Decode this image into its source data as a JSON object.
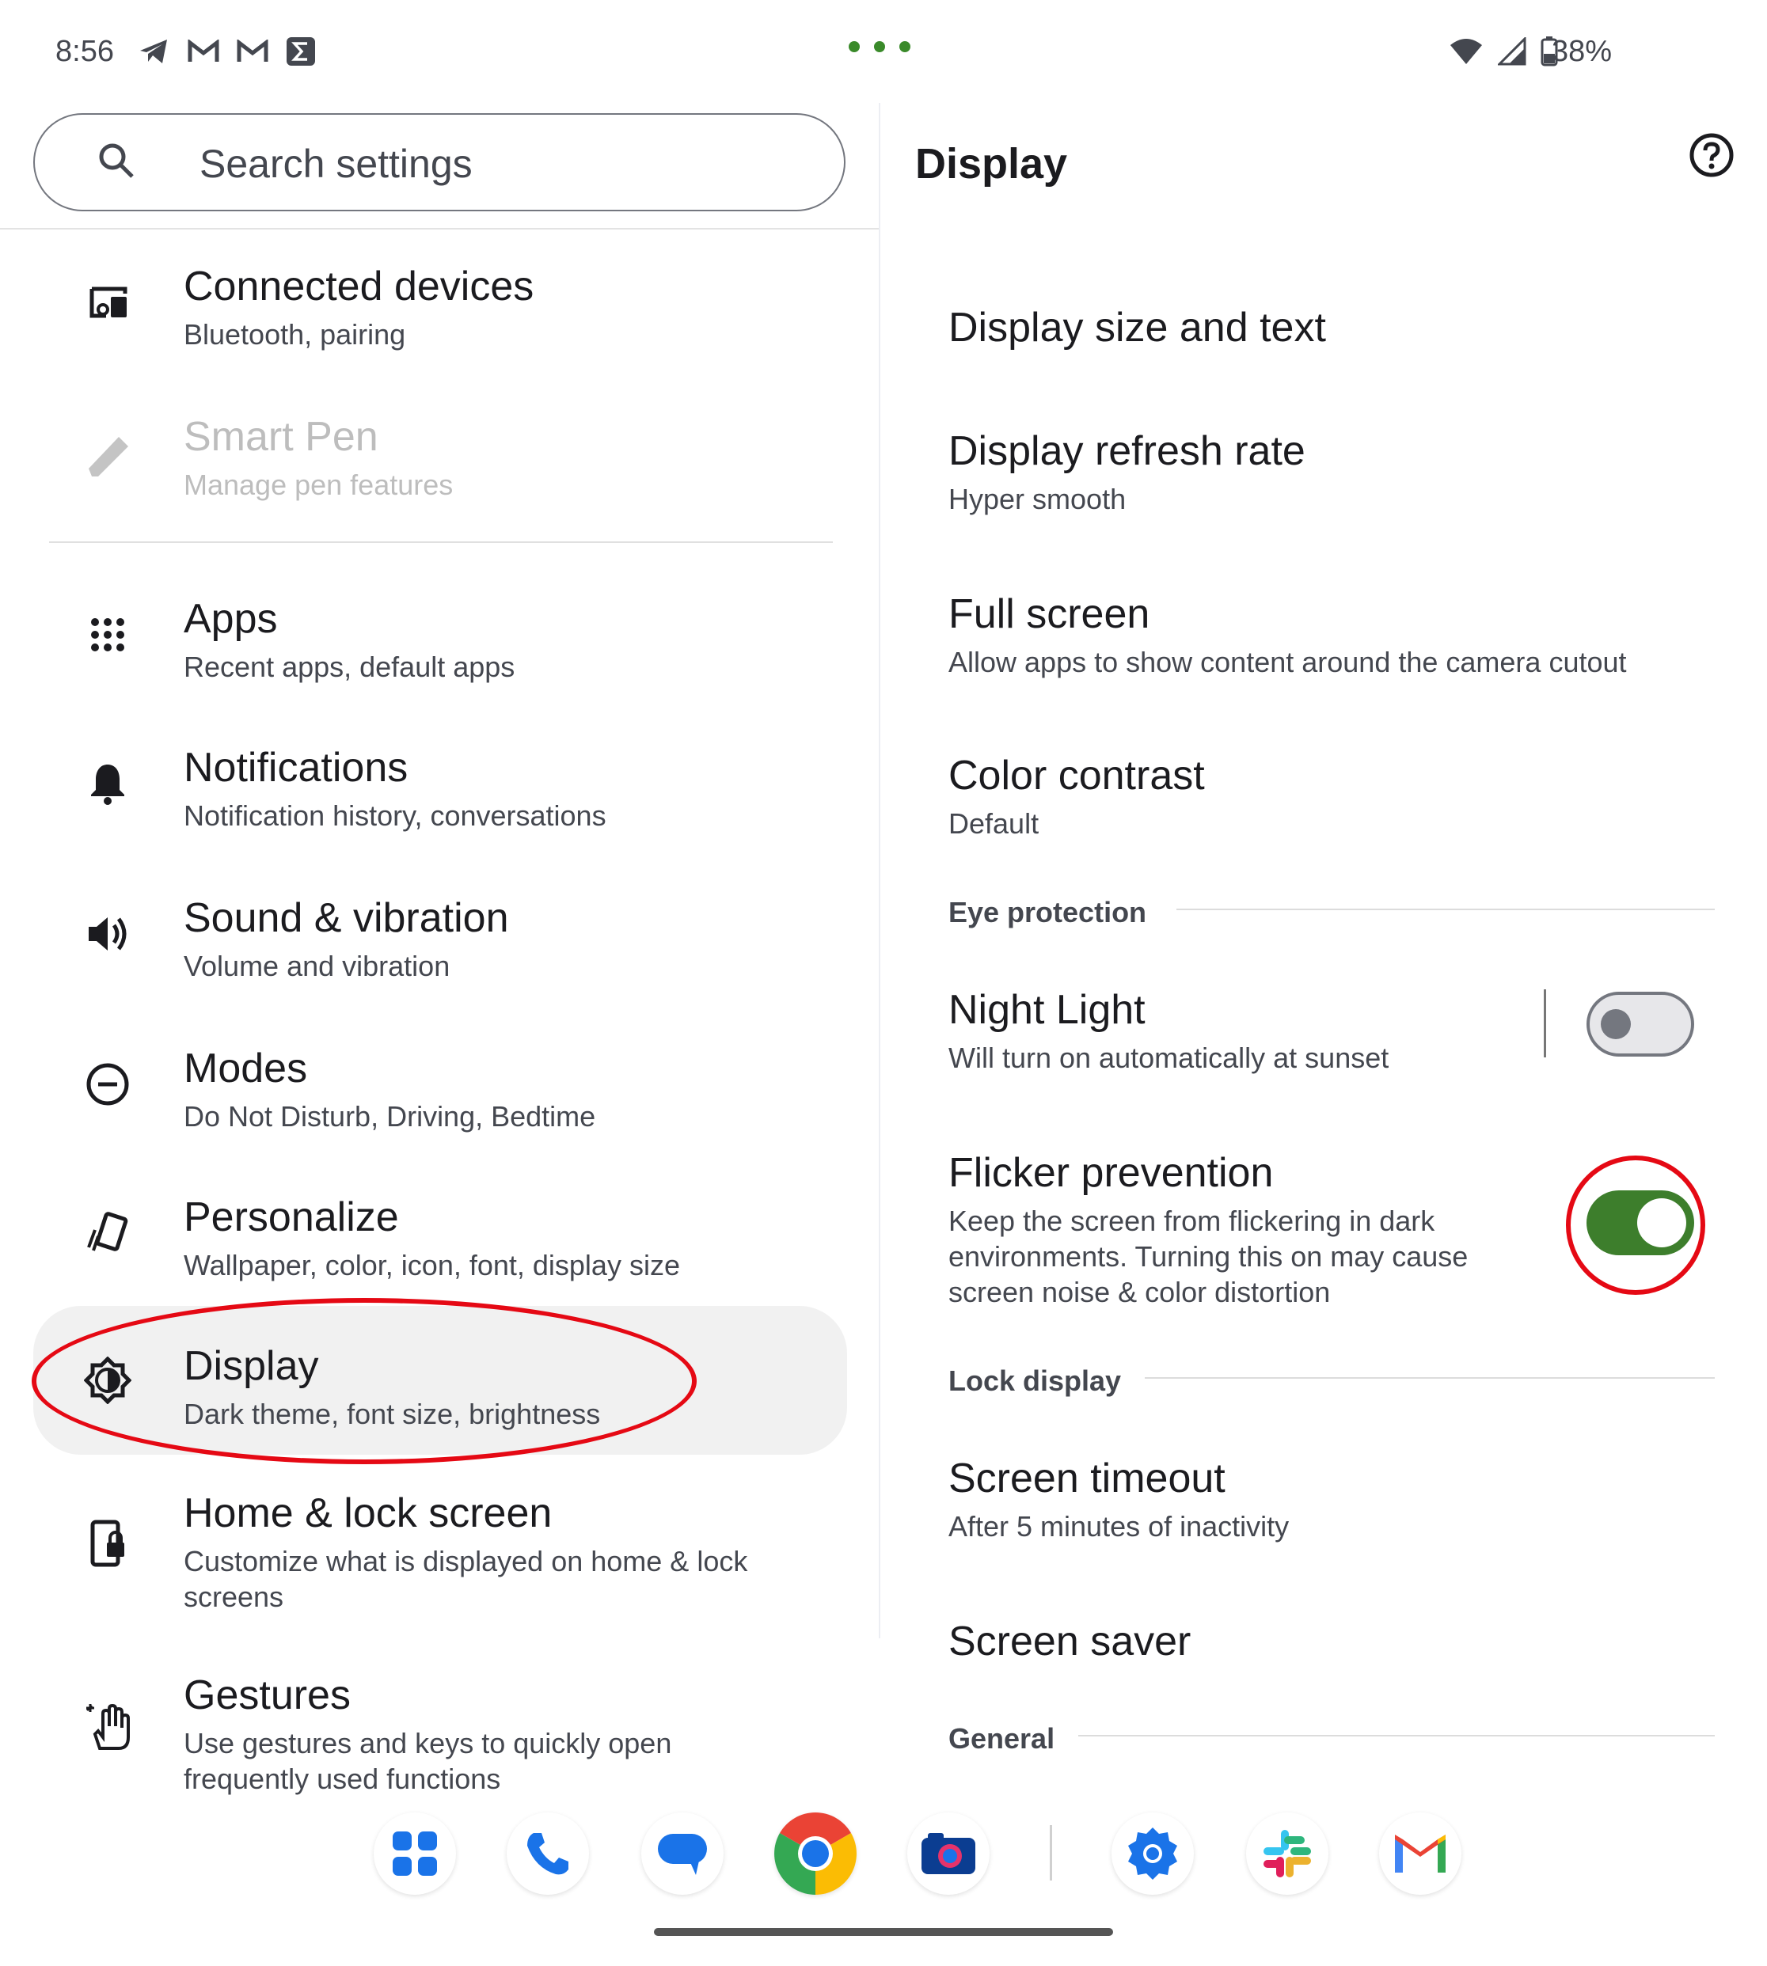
{
  "status_bar": {
    "time": "8:56",
    "battery": "38%",
    "left_icons": [
      "telegram-icon",
      "gmail-icon",
      "gmail-icon",
      "sigma-icon"
    ],
    "right_icons": [
      "wifi-icon",
      "signal-icon",
      "battery-icon"
    ]
  },
  "search": {
    "placeholder": "Search settings"
  },
  "left_menu": {
    "items": [
      {
        "title": "Connected devices",
        "subtitle": "Bluetooth, pairing",
        "icon": "connected-devices-icon"
      },
      {
        "title": "Smart Pen",
        "subtitle": "Manage pen features",
        "icon": "pen-icon",
        "disabled": true
      },
      {
        "title": "Apps",
        "subtitle": "Recent apps, default apps",
        "icon": "apps-grid-icon"
      },
      {
        "title": "Notifications",
        "subtitle": "Notification history, conversations",
        "icon": "bell-icon"
      },
      {
        "title": "Sound & vibration",
        "subtitle": "Volume and vibration",
        "icon": "speaker-icon"
      },
      {
        "title": "Modes",
        "subtitle": "Do Not Disturb, Driving, Bedtime",
        "icon": "modes-icon"
      },
      {
        "title": "Personalize",
        "subtitle": "Wallpaper, color, icon, font, display size",
        "icon": "personalize-icon"
      },
      {
        "title": "Display",
        "subtitle": "Dark theme, font size, brightness",
        "icon": "display-brightness-icon",
        "selected": true
      },
      {
        "title": "Home & lock screen",
        "subtitle_line1": "Customize what is displayed on home & lock",
        "subtitle_line2": "screens",
        "icon": "lock-screen-icon"
      },
      {
        "title": "Gestures",
        "subtitle_line1": "Use gestures and keys to quickly open",
        "subtitle_line2": "frequently used functions",
        "icon": "gesture-hand-icon"
      }
    ]
  },
  "detail": {
    "title": "Display",
    "items": [
      {
        "title": "Display size and text"
      },
      {
        "title": "Display refresh rate",
        "subtitle": "Hyper smooth"
      },
      {
        "title": "Full screen",
        "subtitle": "Allow apps to show content around the camera cutout"
      },
      {
        "title": "Color contrast",
        "subtitle": "Default"
      }
    ],
    "sections": {
      "eye_protection": "Eye protection",
      "lock_display": "Lock display",
      "general": "General"
    },
    "night_light": {
      "title": "Night Light",
      "subtitle": "Will turn on automatically at sunset",
      "enabled": false
    },
    "flicker": {
      "title": "Flicker prevention",
      "subtitle_line1": "Keep the screen from flickering in dark",
      "subtitle_line2": "environments. Turning this on may cause",
      "subtitle_line3": "screen noise & color distortion",
      "enabled": true
    },
    "screen_timeout": {
      "title": "Screen timeout",
      "subtitle": "After 5 minutes of inactivity"
    },
    "screen_saver": {
      "title": "Screen saver"
    }
  },
  "dock": {
    "apps": [
      "app-drawer-icon",
      "phone-icon",
      "messages-icon",
      "chrome-icon",
      "camera-icon",
      "settings-icon",
      "slack-icon",
      "gmail-icon"
    ]
  },
  "colors": {
    "accent_green": "#3d7e2c",
    "highlight_red": "#e50914",
    "selected_bg": "#f1f1f1"
  }
}
